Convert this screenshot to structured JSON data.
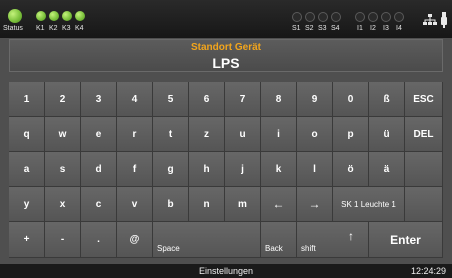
{
  "status_bar": {
    "status_label": "Status",
    "left_indicators": [
      "K1",
      "K2",
      "K3",
      "K4"
    ],
    "right_indicators_s": [
      "S1",
      "S2",
      "S3",
      "S4"
    ],
    "right_indicators_i": [
      "I1",
      "I2",
      "I3",
      "I4"
    ],
    "icons": [
      "status-led",
      "network-icon",
      "usb-icon"
    ],
    "colors": {
      "led_on": "#7dc23d",
      "led_off": "#2a2a2a"
    }
  },
  "header": {
    "destination": "Standort Gerät",
    "value": "LPS",
    "accent_color": "#f2a51c"
  },
  "keyboard": {
    "row1": [
      "1",
      "2",
      "3",
      "4",
      "5",
      "6",
      "7",
      "8",
      "9",
      "0",
      "ß",
      "ESC"
    ],
    "row2": [
      "q",
      "w",
      "e",
      "r",
      "t",
      "z",
      "u",
      "i",
      "o",
      "p",
      "ü",
      "DEL"
    ],
    "row3": [
      "a",
      "s",
      "d",
      "f",
      "g",
      "h",
      "j",
      "k",
      "l",
      "ö",
      "ä"
    ],
    "row4": [
      "y",
      "x",
      "c",
      "v",
      "b",
      "n",
      "m"
    ],
    "arrow_left": "←",
    "arrow_right": "→",
    "suggestion": "SK 1 Leuchte 1",
    "row5": [
      "+",
      "-",
      ".",
      "@"
    ],
    "space": "Space",
    "back": "Back",
    "shift": "shift",
    "shift_arrow": "↑",
    "enter": "Enter"
  },
  "bottom_bar": {
    "title": "Einstellungen",
    "time": "12:24:29"
  }
}
